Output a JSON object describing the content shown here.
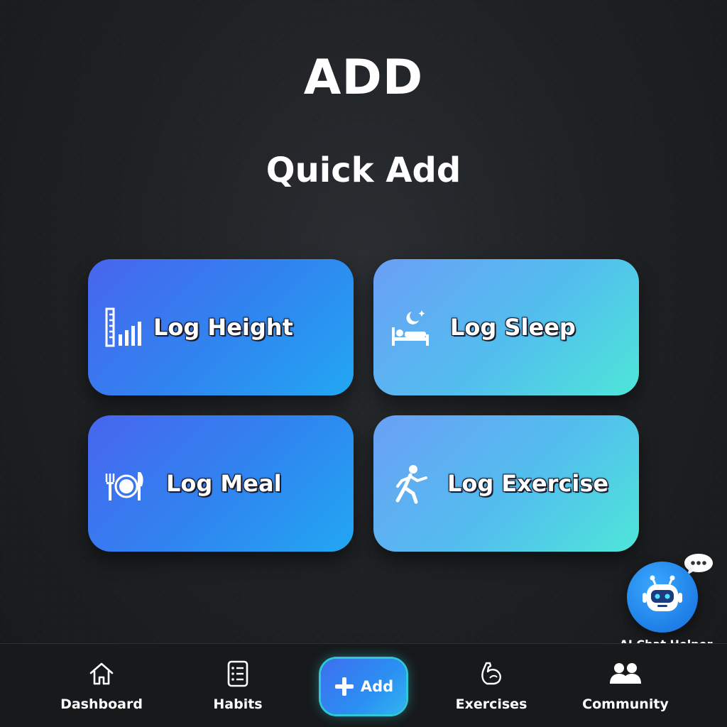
{
  "header": {
    "title": "ADD"
  },
  "quick_add": {
    "title": "Quick Add",
    "tiles": [
      {
        "label": "Log Height",
        "icon": "height-chart-icon",
        "color": "#2f86f0"
      },
      {
        "label": "Log Sleep",
        "icon": "bed-moon-icon",
        "color": "#52bfee"
      },
      {
        "label": "Log Meal",
        "icon": "plate-cutlery-icon",
        "color": "#2f86f0"
      },
      {
        "label": "Log Exercise",
        "icon": "running-person-icon",
        "color": "#52bfee"
      }
    ]
  },
  "chat_helper": {
    "label": "AI Chat Helper",
    "icon": "robot-icon",
    "bubble_icon": "speech-bubble-icon"
  },
  "bottom_nav": {
    "items": [
      {
        "label": "Dashboard",
        "icon": "home-icon"
      },
      {
        "label": "Habits",
        "icon": "checklist-icon"
      },
      {
        "label": "Add",
        "icon": "plus-icon",
        "active": true
      },
      {
        "label": "Exercises",
        "icon": "flexed-arm-icon"
      },
      {
        "label": "Community",
        "icon": "people-icon"
      }
    ]
  },
  "colors": {
    "background": "#1c1e21",
    "accent_blue": "#2f86f0",
    "accent_teal": "#4ee6d8",
    "add_glow": "#2ec8d8"
  }
}
